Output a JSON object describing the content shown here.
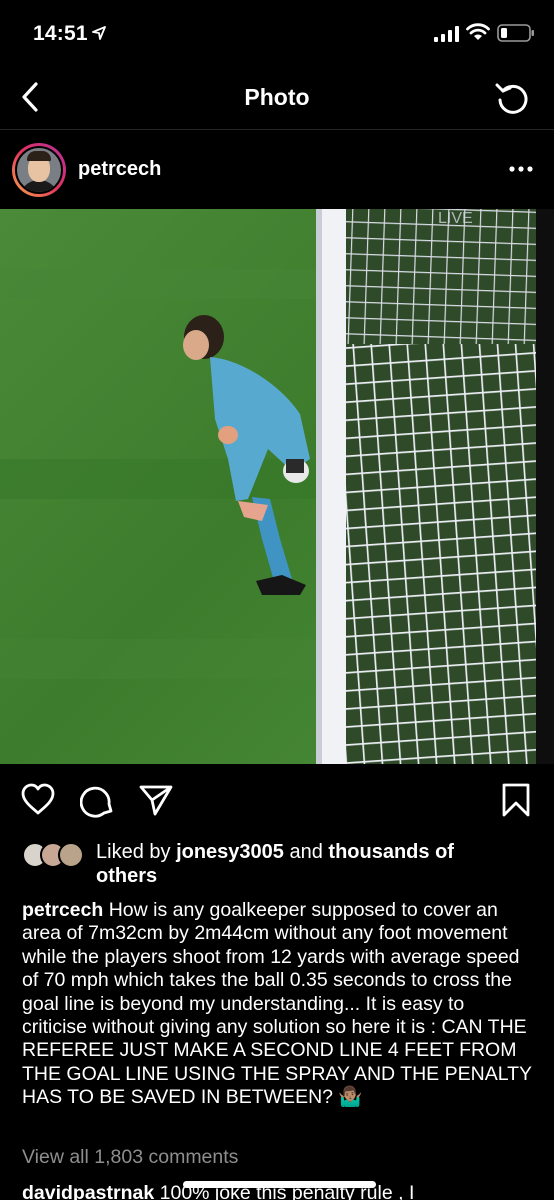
{
  "status_bar": {
    "time": "14:51"
  },
  "nav": {
    "title": "Photo"
  },
  "post": {
    "username": "petrcech",
    "photo_overlay_text": "LIVE"
  },
  "likes": {
    "prefix": "Liked by ",
    "user": "jonesy3005",
    "middle": " and ",
    "rest": "thousands of others"
  },
  "caption": {
    "username": "petrcech",
    "text": " How is any goalkeeper supposed to cover an area of 7m32cm by 2m44cm without any foot movement while the players shoot from 12 yards with average speed of 70 mph which takes the ball 0.35 seconds  to cross the goal line is beyond my understanding... It is easy to criticise without giving any solution so here it is : CAN THE REFEREE JUST MAKE A SECOND LINE 4 FEET FROM THE GOAL LINE USING THE SPRAY AND THE PENALTY HAS TO BE SAVED IN BETWEEN? 🤷🏽‍♂️"
  },
  "comments": {
    "view_all": "View all 1,803 comments",
    "first_user": "davidpastrnak",
    "first_text": " 100% joke this penalty rule , I"
  },
  "colors": {
    "background": "#000000",
    "muted": "#8e8e8e",
    "grass": "#3d7a2e"
  }
}
